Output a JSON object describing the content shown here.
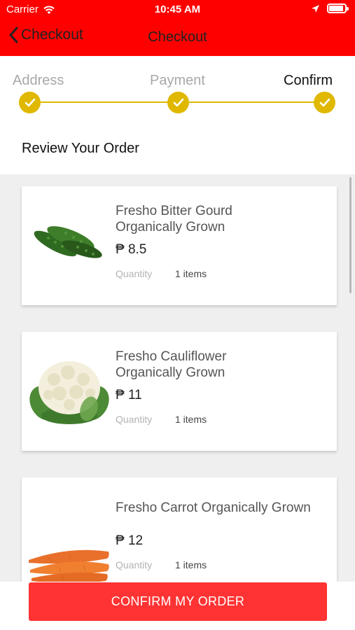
{
  "status_bar": {
    "carrier": "Carrier",
    "time": "10:45 AM",
    "battery_level": 0.9
  },
  "nav": {
    "back_label": "Checkout",
    "title": "Checkout"
  },
  "stepper": {
    "steps": [
      {
        "label": "Address",
        "completed": true,
        "active": false
      },
      {
        "label": "Payment",
        "completed": true,
        "active": false
      },
      {
        "label": "Confirm",
        "completed": true,
        "active": true
      }
    ]
  },
  "review": {
    "title": "Review Your Order"
  },
  "items": [
    {
      "name_line1": "Fresho Bitter Gourd",
      "name_line2": "Organically Grown",
      "price": "₱ 8.5",
      "quantity_label": "Quantity",
      "quantity_value": "1 items",
      "image": "bitter-gourd"
    },
    {
      "name_line1": "Fresho Cauliflower",
      "name_line2": "Organically Grown",
      "price": "₱ 11",
      "quantity_label": "Quantity",
      "quantity_value": "1 items",
      "image": "cauliflower"
    },
    {
      "name_line1": "Fresho Carrot  Organically Grown",
      "name_line2": "",
      "price": "₱ 12",
      "quantity_label": "Quantity",
      "quantity_value": "1 items",
      "image": "carrot"
    }
  ],
  "footer": {
    "confirm_label": "CONFIRM MY ORDER"
  },
  "colors": {
    "header": "#ff0000",
    "accent": "#e0b800",
    "button": "#ff3333"
  }
}
